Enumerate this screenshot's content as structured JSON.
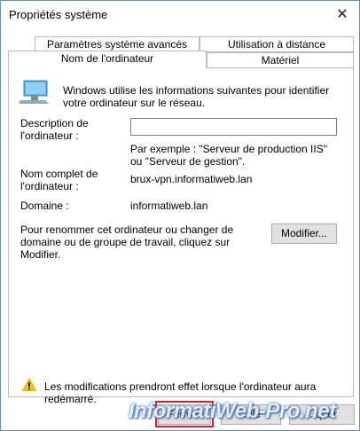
{
  "window": {
    "title": "Propriétés système",
    "close_glyph": "✕"
  },
  "tabs": {
    "row_back": [
      "Paramètres système avancés",
      "Utilisation à distance"
    ],
    "row_front": [
      "Nom de l'ordinateur",
      "Matériel"
    ],
    "active": "Nom de l'ordinateur"
  },
  "intro": "Windows utilise les informations suivantes pour identifier votre ordinateur sur le réseau.",
  "description": {
    "label": "Description de l'ordinateur :",
    "value": "",
    "hint": "Par exemple : \"Serveur de production IIS\" ou \"Serveur de gestion\"."
  },
  "full_name": {
    "label": "Nom complet de l'ordinateur :",
    "value": "brux-vpn.informatiweb.lan"
  },
  "domain": {
    "label": "Domaine :",
    "value": "informatiweb.lan"
  },
  "rename": {
    "text": "Pour renommer cet ordinateur ou changer de domaine ou de groupe de travail, cliquez sur Modifier.",
    "button": "Modifier..."
  },
  "warning": "Les modifications prendront effet lorsque l'ordinateur aura redémarré.",
  "footer": {
    "ok": "Fermer",
    "cancel": "...ile",
    "apply": "...quer"
  },
  "watermark": "InformatiWeb-Pro.net",
  "colors": {
    "highlight": "#e02020",
    "accent": "#1d4e8f"
  }
}
